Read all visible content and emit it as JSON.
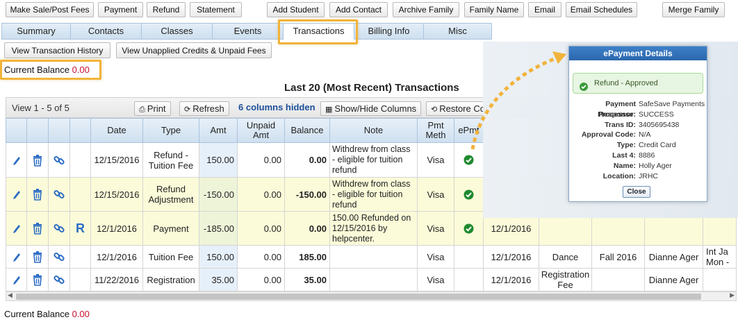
{
  "top_buttons": [
    {
      "label": "Make Sale/Post Fees"
    },
    {
      "label": "Payment"
    },
    {
      "label": "Refund"
    },
    {
      "label": "Statement"
    },
    {
      "label": "Add Student"
    },
    {
      "label": "Add Contact"
    },
    {
      "label": "Archive Family"
    },
    {
      "label": "Family Name"
    },
    {
      "label": "Email"
    },
    {
      "label": "Email Schedules"
    },
    {
      "label": "Merge Family"
    }
  ],
  "tabs": [
    {
      "label": "Summary"
    },
    {
      "label": "Contacts"
    },
    {
      "label": "Classes"
    },
    {
      "label": "Events"
    },
    {
      "label": "Transactions"
    },
    {
      "label": "Billing Info"
    },
    {
      "label": "Misc"
    }
  ],
  "sub_buttons": {
    "history": "View Transaction History",
    "unapplied": "View Unapplied Credits & Unpaid Fees"
  },
  "current_balance": {
    "label": "Current Balance",
    "value": "0.00"
  },
  "grid": {
    "title": "Last 20 (Most Recent) Transactions",
    "view_count": "View 1 - 5 of 5",
    "print": "Print",
    "refresh": "Refresh",
    "hidden_cols": "6 columns hidden",
    "show_hide": "Show/Hide Columns",
    "restore": "Restore Co",
    "headers": {
      "date": "Date",
      "type": "Type",
      "amt": "Amt",
      "unpaid": "Unpaid Amt",
      "balance": "Balance",
      "note": "Note",
      "pmt": "Pmt Meth",
      "epmt": "ePmt"
    },
    "rows": [
      {
        "date": "12/15/2016",
        "type": "Refund - Tuition Fee",
        "amt": "150.00",
        "unpaid": "0.00",
        "balance": "0.00",
        "note": "Withdrew from class - eligible for tuition refund",
        "pmt": "Visa",
        "r": "",
        "d2": "",
        "c3": "",
        "c4": "",
        "c5": "",
        "c6": ""
      },
      {
        "date": "12/15/2016",
        "type": "Refund Adjustment",
        "amt": "-150.00",
        "unpaid": "0.00",
        "balance": "-150.00",
        "note": "Withdrew from class - eligible for tuition refund",
        "pmt": "Visa",
        "r": "",
        "d2": "",
        "c3": "",
        "c4": "",
        "c5": "",
        "c6": ""
      },
      {
        "date": "12/1/2016",
        "type": "Payment",
        "amt": "-185.00",
        "unpaid": "0.00",
        "balance": "0.00",
        "note": "150.00 Refunded on 12/15/2016 by helpcenter.",
        "pmt": "Visa",
        "r": "R",
        "d2": "12/1/2016",
        "c3": "",
        "c4": "",
        "c5": "",
        "c6": ""
      },
      {
        "date": "12/1/2016",
        "type": "Tuition Fee",
        "amt": "150.00",
        "unpaid": "0.00",
        "balance": "185.00",
        "note": "",
        "pmt": "Visa",
        "r": "",
        "d2": "12/1/2016",
        "c3": "Dance",
        "c4": "Fall 2016",
        "c5": "Dianne Ager",
        "c6": "Int Ja Mon -"
      },
      {
        "date": "11/22/2016",
        "type": "Registration",
        "amt": "35.00",
        "unpaid": "0.00",
        "balance": "35.00",
        "note": "",
        "pmt": "Visa",
        "r": "",
        "d2": "12/1/2016",
        "c3": "Registration Fee",
        "c4": "",
        "c5": "Dianne Ager",
        "c6": ""
      }
    ]
  },
  "popup": {
    "title": "ePayment Details",
    "status": "Refund - Approved",
    "fields": [
      {
        "k": "Payment Processor:",
        "v": "SafeSave Payments"
      },
      {
        "k": "Response:",
        "v": "SUCCESS"
      },
      {
        "k": "Trans ID:",
        "v": "3405695438"
      },
      {
        "k": "Approval Code:",
        "v": "N/A"
      },
      {
        "k": "Type:",
        "v": "Credit Card"
      },
      {
        "k": "Last 4:",
        "v": "8886"
      },
      {
        "k": "Name:",
        "v": "Holly Ager"
      },
      {
        "k": "Location:",
        "v": "JRHC"
      }
    ],
    "close": "Close"
  },
  "colors": {
    "accent": "#2b67ad",
    "highlight": "#f2b33a",
    "balance_value": "#c8102e",
    "row_yellow": "#fbfbd9"
  }
}
